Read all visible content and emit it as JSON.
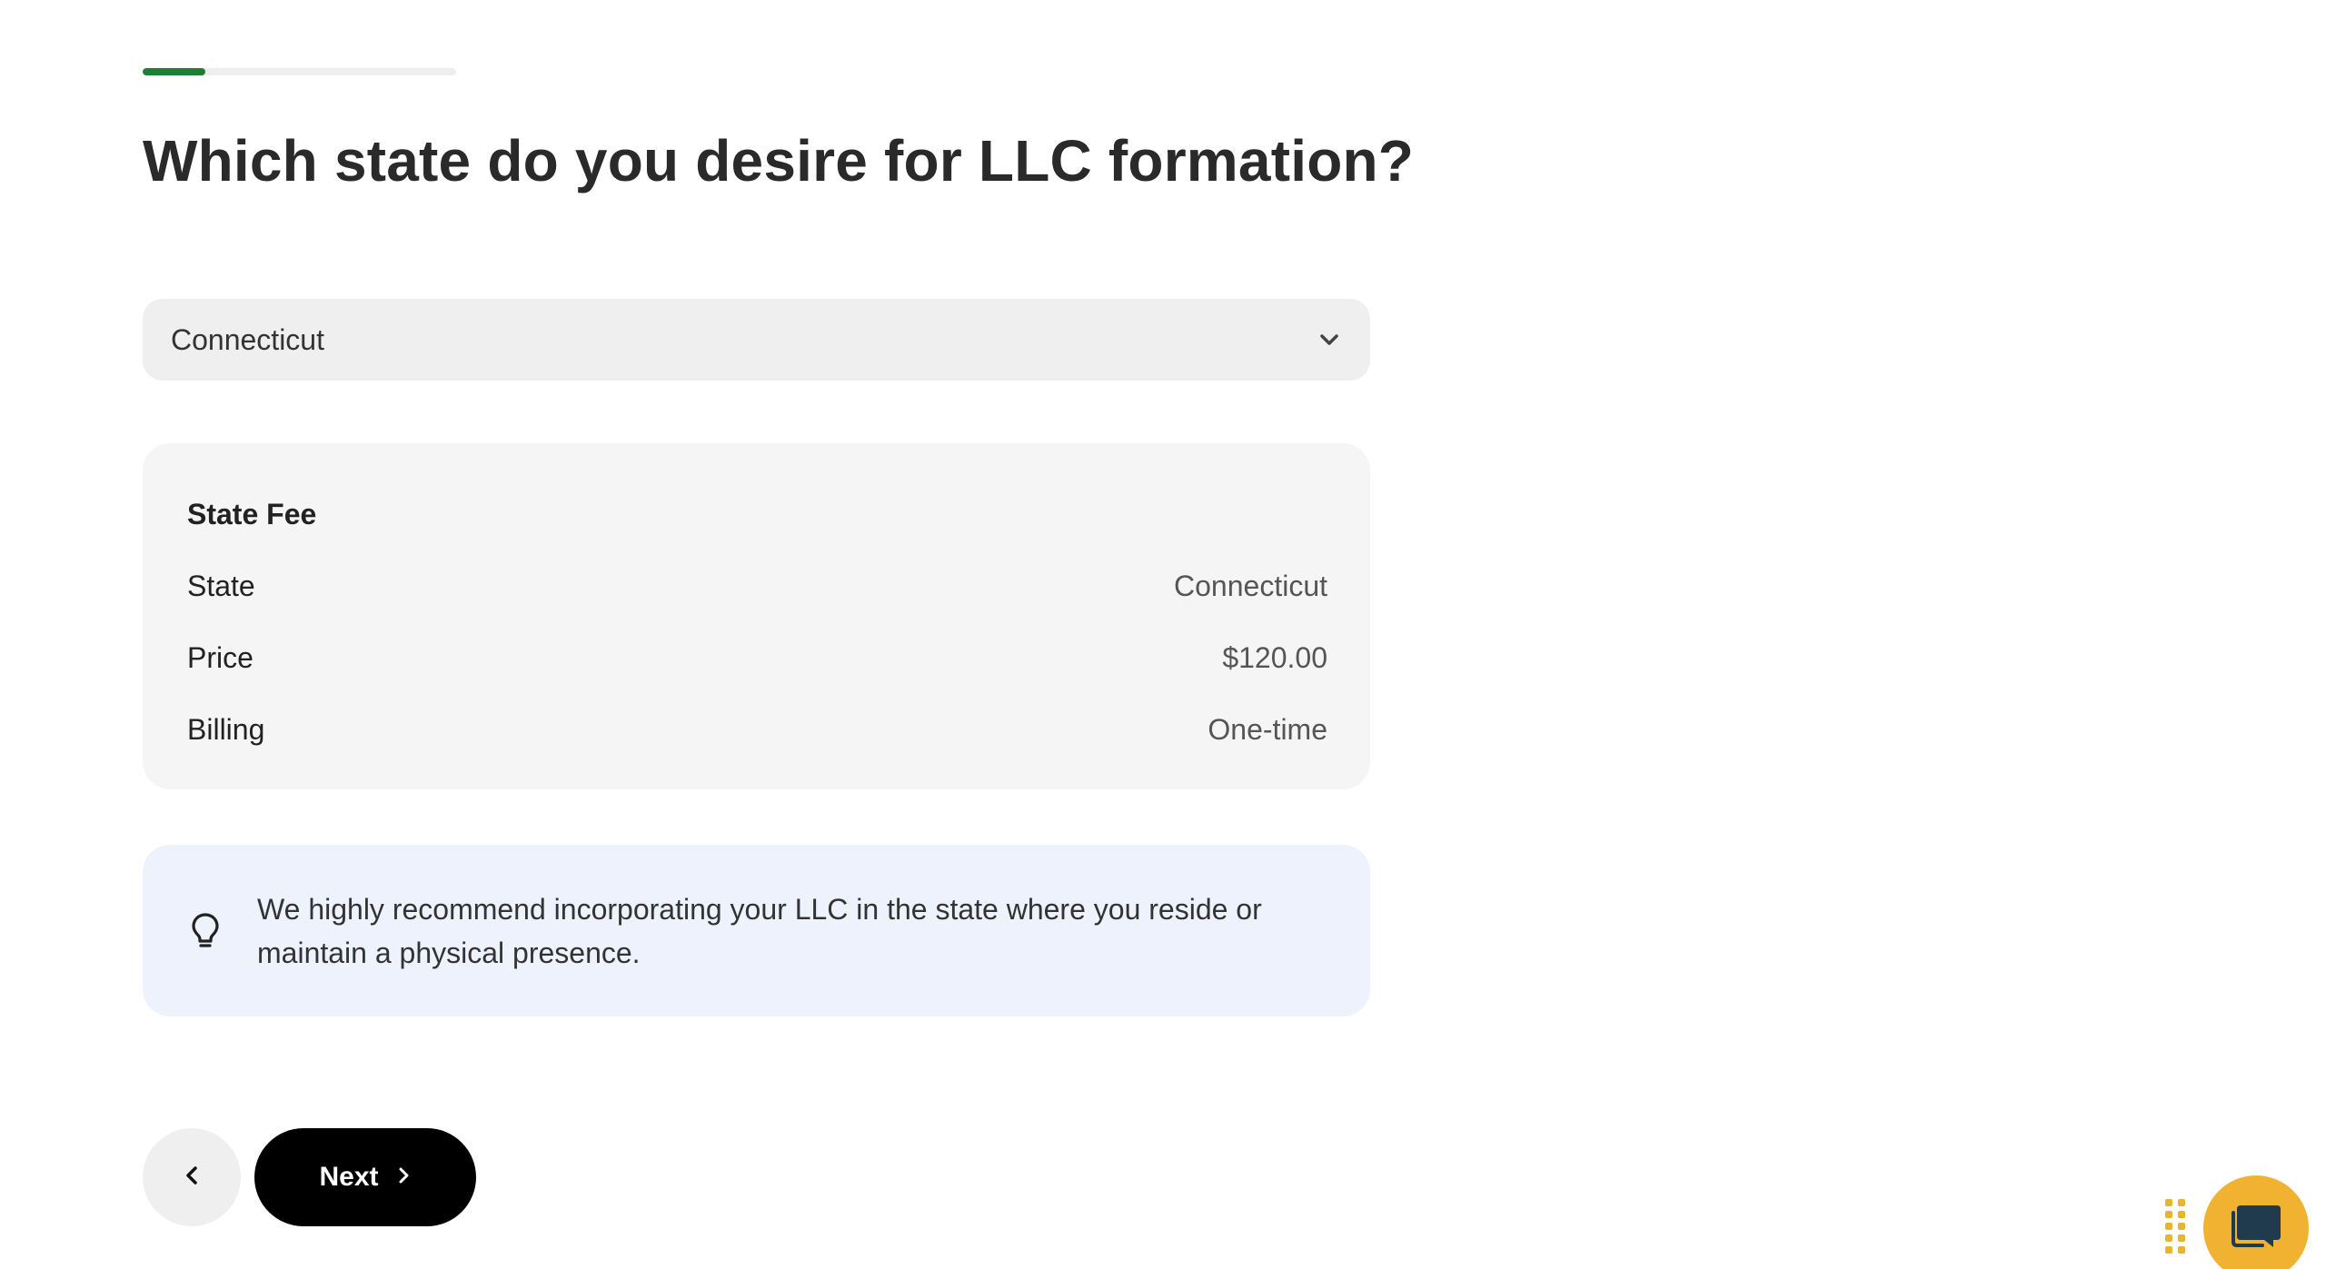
{
  "progress": {
    "value_fraction": 0.2,
    "color": "#1e7e34"
  },
  "question": {
    "title": "Which state do you desire for LLC formation?"
  },
  "state_select": {
    "selected_value": "Connecticut",
    "icon": "chevron-down-icon"
  },
  "fee_card": {
    "title": "State Fee",
    "rows": [
      {
        "label": "State",
        "value": "Connecticut"
      },
      {
        "label": "Price",
        "value": "$120.00"
      },
      {
        "label": "Billing",
        "value": "One-time"
      }
    ]
  },
  "tip": {
    "icon": "lightbulb-icon",
    "text": "We highly recommend incorporating your LLC in the state where you reside or maintain a physical presence."
  },
  "navigation": {
    "back_icon": "chevron-left-icon",
    "next_label": "Next",
    "next_icon": "chevron-right-icon"
  },
  "chat_widget": {
    "icon": "chat-bubble-icon",
    "handle_icon": "drag-handle-icon",
    "accent": "#f2b231"
  }
}
